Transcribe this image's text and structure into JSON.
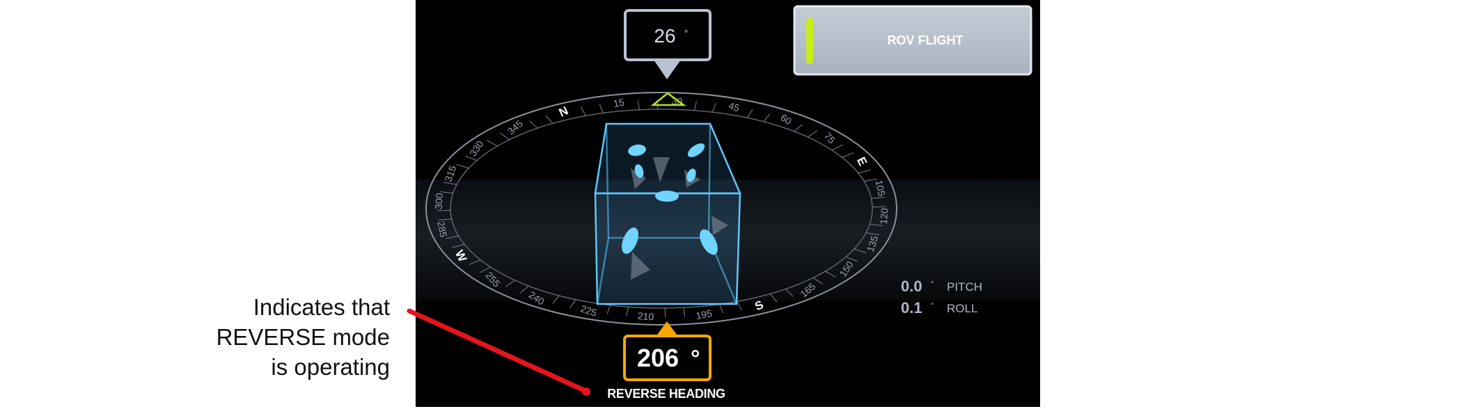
{
  "mode_panel": {
    "label": "ROV FLIGHT",
    "indicator_color": "#c8ee1a"
  },
  "target_heading": {
    "value": "26",
    "unit": "°"
  },
  "current_heading": {
    "value": "206",
    "unit": "°"
  },
  "reverse_heading_label": "REVERSE HEADING",
  "cardinals": {
    "north": "N",
    "east": "E",
    "south": "S",
    "west": "W"
  },
  "compass_ticks": [
    "15",
    "30",
    "45",
    "60",
    "75",
    "105",
    "120",
    "135",
    "150",
    "165",
    "195",
    "210",
    "225",
    "240",
    "255",
    "285",
    "300",
    "315",
    "330",
    "345"
  ],
  "attitude": {
    "pitch": {
      "value": "0.0",
      "unit": "°",
      "label": "PITCH"
    },
    "roll": {
      "value": "0.1",
      "unit": "°",
      "label": "ROLL"
    }
  },
  "annotation": {
    "lines": [
      "Indicates that",
      "REVERSE mode",
      "is operating"
    ],
    "color": "#e8141b"
  },
  "colors": {
    "panel_bg": "#000000",
    "target_box": "#b9c3d3",
    "heading_box": "#f5a800",
    "cube_edge": "#5fc8ff",
    "thruster": "#6fd4ff"
  }
}
